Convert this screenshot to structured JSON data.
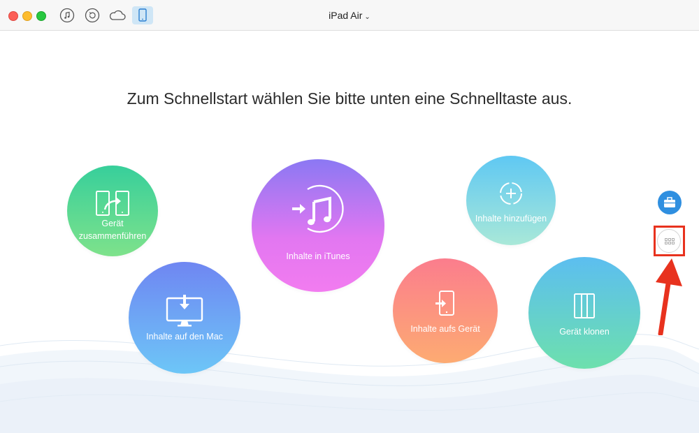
{
  "window": {
    "device_name": "iPad Air",
    "device_chevron": "⌄"
  },
  "toolbar": {
    "icons": [
      "music-icon",
      "restore-icon",
      "cloud-icon",
      "ipad-icon"
    ],
    "active": "ipad-icon"
  },
  "main": {
    "headline": "Zum Schnellstart wählen Sie bitte unten eine Schnelltaste aus.",
    "shortcuts": {
      "merge_line1": "Gerät",
      "merge_line2": "zusammenführen",
      "to_mac": "Inhalte auf den Mac",
      "to_itunes": "Inhalte in iTunes",
      "add_content": "Inhalte hinzufügen",
      "to_device": "Inhalte aufs Gerät",
      "clone": "Gerät klonen"
    }
  },
  "sidebar": {
    "buttons": [
      "toolbox-icon",
      "more-apps-icon"
    ]
  },
  "colors": {
    "highlight": "#e8321e",
    "toolbox": "#2f8fe0"
  }
}
